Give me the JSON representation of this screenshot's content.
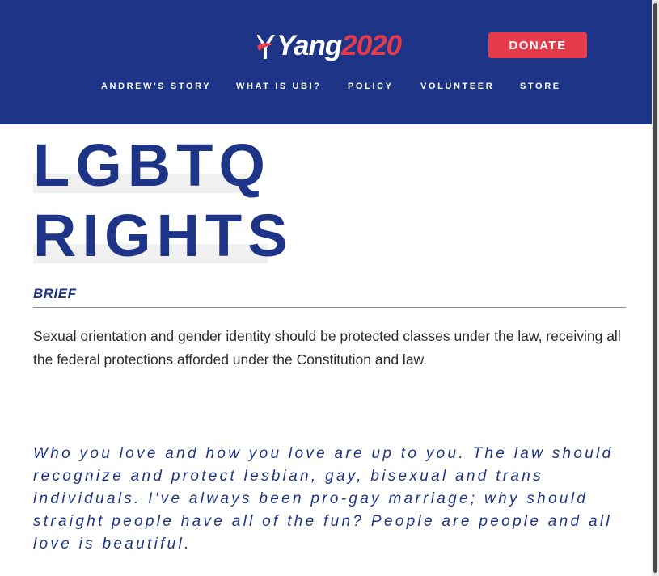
{
  "header": {
    "logo": {
      "text_primary": "Yang",
      "text_secondary": "2020"
    },
    "donate_label": "DONATE",
    "nav": [
      {
        "label": "ANDREW'S STORY"
      },
      {
        "label": "WHAT IS UBI?"
      },
      {
        "label": "POLICY"
      },
      {
        "label": "VOLUNTEER"
      },
      {
        "label": "STORE"
      }
    ]
  },
  "page": {
    "title_line1": "LGBTQ",
    "title_line2": "RIGHTS",
    "section_label": "BRIEF",
    "summary": "Sexual orientation and gender identity should be protected classes under the law, receiving all the federal protections afforded under the Constitution and law.",
    "quote": "Who you love and how you love are up to you. The law should recognize and protect lesbian, gay, bisexual and trans individuals. I've always been pro-gay marriage; why should straight people have all of the fun? People are people and all love is beautiful."
  },
  "colors": {
    "brand_blue": "#1e3587",
    "brand_red": "#e43b4c",
    "title_highlight": "#f0f0f0"
  }
}
